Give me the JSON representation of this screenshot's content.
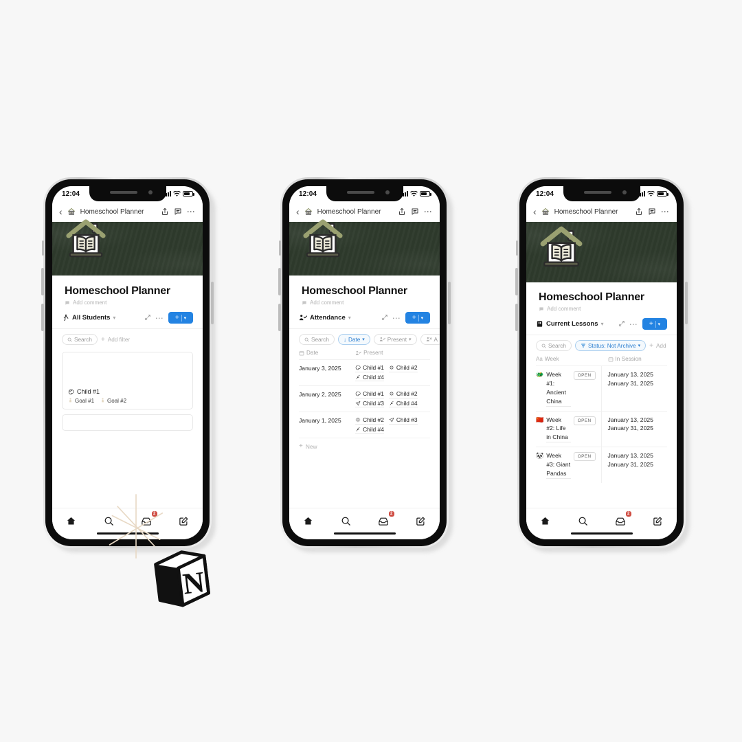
{
  "canvas": {
    "background": "#f7f7f7"
  },
  "brand": {
    "accent": "#2383e2",
    "cover": "#2e3a2c",
    "badge": "#cf4d43",
    "chip_active_text": "#2d7fd0"
  },
  "status_bar": {
    "time": "12:04",
    "signal_icon": "cellular-bars-icon",
    "wifi_icon": "wifi-icon",
    "battery_icon": "battery-icon"
  },
  "app_nav": {
    "back_icon": "chevron-left-icon",
    "page_icon": "house-book-icon",
    "title": "Homeschool Planner",
    "share_icon": "share-icon",
    "comment_icon": "comment-icon",
    "more_icon": "more-horizontal-icon"
  },
  "page": {
    "icon": "house-book-icon",
    "title": "Homeschool Planner",
    "add_comment_label": "Add comment",
    "add_comment_icon": "comment-icon"
  },
  "tab_bar": {
    "items": [
      {
        "name": "home",
        "icon": "home-icon",
        "badge": ""
      },
      {
        "name": "search",
        "icon": "search-icon",
        "badge": ""
      },
      {
        "name": "inbox",
        "icon": "inbox-icon",
        "badge": "2"
      },
      {
        "name": "new-page",
        "icon": "edit-square-icon",
        "badge": ""
      }
    ]
  },
  "shared_toolbar": {
    "expand_icon": "expand-arrows-icon",
    "more_icon": "more-horizontal-icon",
    "new_label": "+",
    "new_caret": "chevron-down-icon",
    "view_caret": "chevron-down-icon"
  },
  "phones": [
    {
      "id": "phone-students",
      "view": {
        "icon": "person-walking-icon",
        "name": "All Students"
      },
      "chips": [
        {
          "type": "search",
          "icon": "search-icon",
          "label": "Search",
          "active": false
        },
        {
          "type": "add-filter",
          "icon": "plus-icon",
          "label": "Add filter",
          "active": false,
          "plain": true
        }
      ],
      "gallery": {
        "cards": [
          {
            "title_icon": "palette-icon",
            "title": "Child #1",
            "tags": [
              {
                "icon": "person-icon",
                "label": "Goal #1"
              },
              {
                "icon": "person-icon",
                "label": "Goal #2"
              }
            ]
          },
          {
            "partial": true
          }
        ]
      }
    },
    {
      "id": "phone-attendance",
      "view": {
        "icon": "person-check-icon",
        "name": "Attendance"
      },
      "chips": [
        {
          "type": "search",
          "icon": "search-icon",
          "label": "Search",
          "active": false
        },
        {
          "type": "sort",
          "icon": "arrow-down-icon",
          "label": "Date",
          "caret": "chevron-down-icon",
          "active": true
        },
        {
          "type": "filter",
          "icon": "person-check-icon",
          "label": "Present",
          "caret": "chevron-down-icon",
          "active": false
        },
        {
          "type": "filter",
          "icon": "person-x-icon",
          "label": "A",
          "active": false
        }
      ],
      "table": {
        "columns": [
          {
            "icon": "calendar-icon",
            "label": "Date"
          },
          {
            "icon": "person-check-icon",
            "label": "Present"
          }
        ],
        "rows": [
          {
            "date": "January 3, 2025",
            "people": [
              {
                "icon": "palette-icon",
                "label": "Child #1"
              },
              {
                "icon": "burst-icon",
                "label": "Child #2"
              },
              {
                "icon": "feather-icon",
                "label": "Child #4"
              }
            ]
          },
          {
            "date": "January 2, 2025",
            "people": [
              {
                "icon": "palette-icon",
                "label": "Child #1"
              },
              {
                "icon": "burst-icon",
                "label": "Child #2"
              },
              {
                "icon": "paper-plane-icon",
                "label": "Child #3"
              },
              {
                "icon": "feather-icon",
                "label": "Child #4"
              }
            ]
          },
          {
            "date": "January 1, 2025",
            "people": [
              {
                "icon": "burst-icon",
                "label": "Child #2"
              },
              {
                "icon": "paper-plane-icon",
                "label": "Child #3"
              },
              {
                "icon": "feather-icon",
                "label": "Child #4"
              }
            ]
          }
        ],
        "new_row_label": "New",
        "new_row_icon": "plus-icon"
      }
    },
    {
      "id": "phone-lessons",
      "view": {
        "icon": "book-closed-icon",
        "name": "Current Lessons"
      },
      "chips": [
        {
          "type": "search",
          "icon": "search-icon",
          "label": "Search",
          "active": false
        },
        {
          "type": "filter",
          "icon": "filter-layers-icon",
          "label": "Status: Not Archive",
          "caret": "chevron-down-icon",
          "active": true
        },
        {
          "type": "add-filter",
          "icon": "plus-icon",
          "label": "Add",
          "active": false,
          "plain": true
        }
      ],
      "table": {
        "columns": [
          {
            "icon": "text-aa-icon",
            "label": "Week"
          },
          {
            "icon": "calendar-icon",
            "label": "In Session"
          }
        ],
        "rows": [
          {
            "emoji": "dragon-emoji",
            "name": "Week #1: Ancient China",
            "badge": "OPEN",
            "dates": [
              "January 13, 2025",
              "January 31, 2025"
            ]
          },
          {
            "emoji": "china-flag-emoji",
            "name": "Week #2: Life in China",
            "badge": "OPEN",
            "dates": [
              "January 13, 2025",
              "January 31, 2025"
            ]
          },
          {
            "emoji": "panda-emoji",
            "name": "Week #3: Giant Pandas",
            "badge": "OPEN",
            "dates": [
              "January 13, 2025",
              "January 31, 2025"
            ]
          }
        ]
      }
    }
  ],
  "decorations": {
    "sparkle": "sparkle-star-icon",
    "notion_cube": "notion-logo-icon"
  }
}
